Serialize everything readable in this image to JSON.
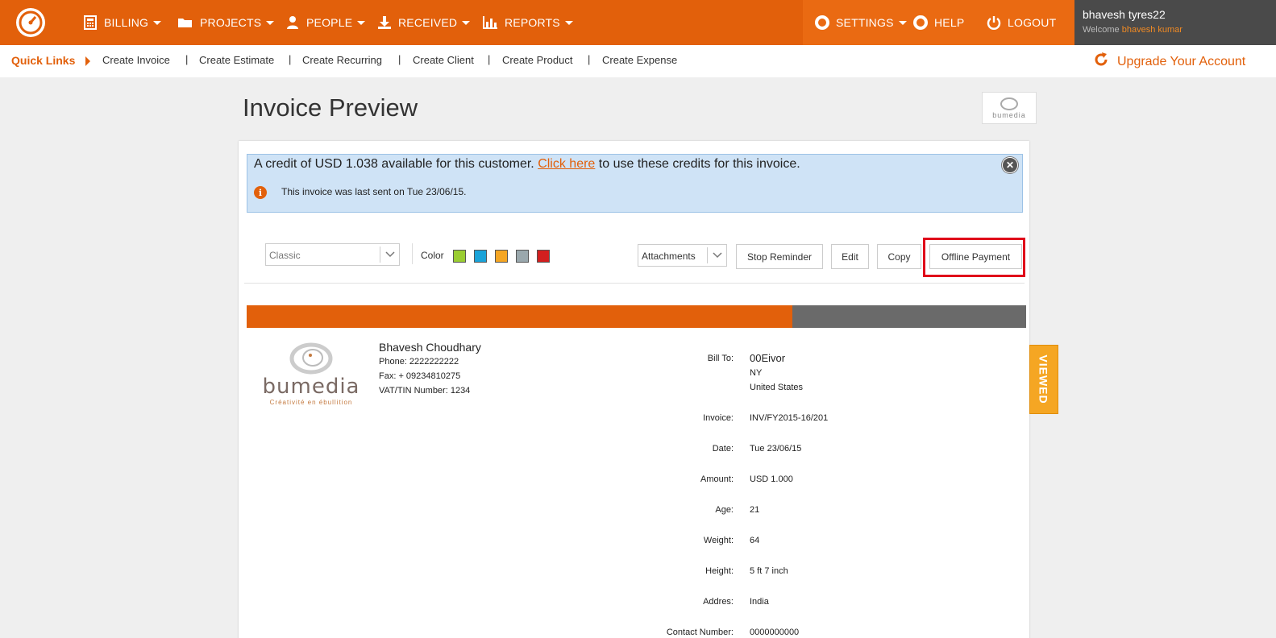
{
  "nav": {
    "items": [
      {
        "label": "BILLING",
        "icon": "calculator-icon"
      },
      {
        "label": "PROJECTS",
        "icon": "folder-icon"
      },
      {
        "label": "PEOPLE",
        "icon": "user-icon"
      },
      {
        "label": "RECEIVED",
        "icon": "download-icon"
      },
      {
        "label": "REPORTS",
        "icon": "bar-chart-icon"
      }
    ],
    "settings": "SETTINGS",
    "help": "HELP",
    "logout": "LOGOUT",
    "user_name": "bhavesh tyres22",
    "welcome_prefix": "Welcome",
    "welcome_name": "bhavesh kumar",
    "accent": "#e2600b"
  },
  "quick_links": {
    "title": "Quick Links",
    "links": [
      "Create Invoice",
      "Create Estimate",
      "Create Recurring",
      "Create Client",
      "Create Product",
      "Create Expense"
    ],
    "separator": "|",
    "upgrade": "Upgrade Your Account"
  },
  "page": {
    "title": "Invoice Preview",
    "brand_word": "bumedia"
  },
  "credit": {
    "prefix": "A credit of USD 1.038 available for this customer.",
    "link": "Click here",
    "suffix": "to use these credits for this invoice.",
    "info": "This invoice was last sent on Tue 23/06/15."
  },
  "toolbar": {
    "template_value": "Classic",
    "color_label": "Color",
    "colors": [
      "#9acd32",
      "#1aa3d9",
      "#f5a623",
      "#9aa8ad",
      "#d21f1f"
    ],
    "attachments_value": "Attachments",
    "stop_reminder": "Stop Reminder",
    "edit": "Edit",
    "copy": "Copy",
    "offline_payment": "Offline Payment"
  },
  "invoice": {
    "logo_word": "bumedia",
    "logo_tag": "Créativité en ébullition",
    "company_name": "Bhavesh Choudhary",
    "phone": "Phone: 2222222222",
    "fax": "Fax: + 09234810275",
    "vat": "VAT/TIN Number: 1234",
    "bill_to_label": "Bill To:",
    "bill_to_name": "00Eivor",
    "bill_to_state": "NY",
    "bill_to_country": "United States",
    "fields": [
      {
        "label": "Invoice:",
        "value": "INV/FY2015-16/201"
      },
      {
        "label": "Date:",
        "value": "Tue 23/06/15"
      },
      {
        "label": "Amount:",
        "value": "USD 1.000"
      },
      {
        "label": "Age:",
        "value": "21"
      },
      {
        "label": "Weight:",
        "value": "64"
      },
      {
        "label": "Height:",
        "value": "5 ft 7 inch"
      },
      {
        "label": "Addres:",
        "value": "India"
      },
      {
        "label": "Contact Number:",
        "value": "0000000000"
      }
    ],
    "status": "VIEWED"
  }
}
